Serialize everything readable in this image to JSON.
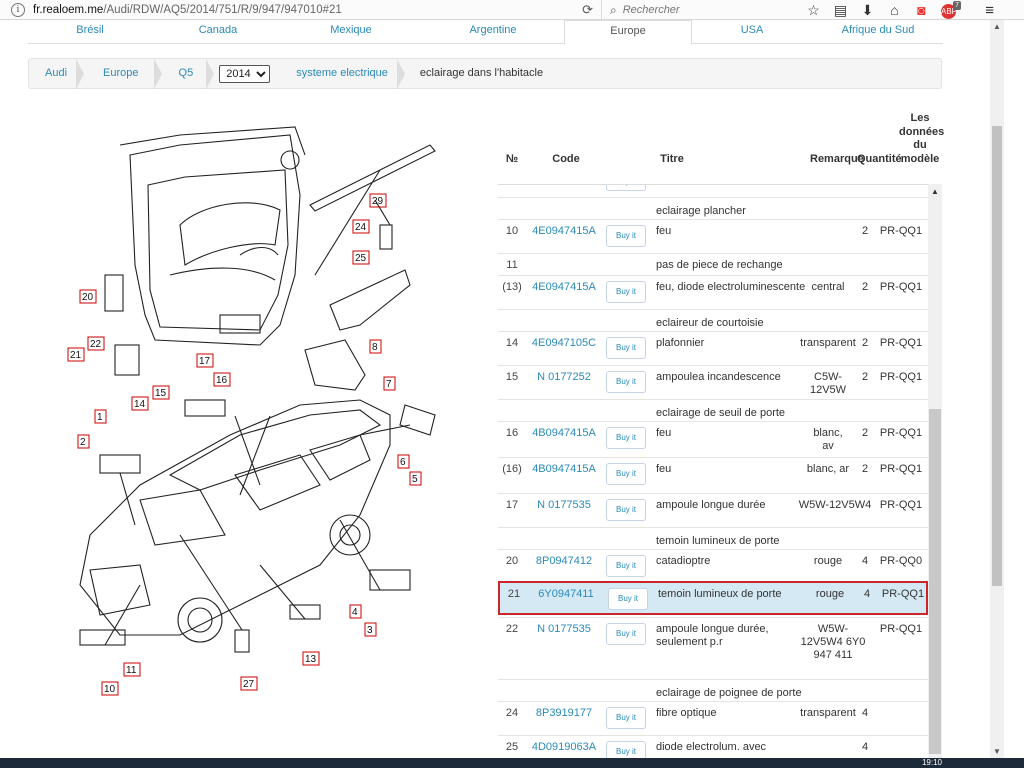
{
  "browser": {
    "url_domain": "fr.realoem.me",
    "url_path": "/Audi/RDW/AQ5/2014/751/R/9/947/947010#21",
    "search_placeholder": "Rechercher",
    "adblock_badge": "7"
  },
  "country_tabs": [
    "Brésil",
    "Canada",
    "Mexique",
    "Argentine",
    "Europe",
    "USA",
    "Afrique du Sud"
  ],
  "active_tab": "Europe",
  "breadcrumb": {
    "brand": "Audi",
    "region": "Europe",
    "model": "Q5",
    "year": "2014",
    "group": "systeme electrique",
    "current": "eclairage dans l'habitacle"
  },
  "diagram_labels": [
    "1",
    "2",
    "3",
    "4",
    "5",
    "6",
    "7",
    "8",
    "10",
    "11",
    "13",
    "14",
    "15",
    "16",
    "17",
    "20",
    "21",
    "22",
    "24",
    "25",
    "27",
    "29"
  ],
  "table": {
    "headers": {
      "num": "№",
      "code": "Code",
      "title": "Titre",
      "remark": "Remarque",
      "qty": "Quantité",
      "model": "Les données du modèle"
    },
    "buy_label": "Buy it",
    "groups": [
      "eclairage plancher",
      "eclaireur de courtoisie",
      "eclairage de seuil de porte",
      "temoin lumineux de porte",
      "eclairage de poignee de porte"
    ],
    "rows": [
      {
        "num": "10",
        "code": "4E0947415A",
        "title": "feu",
        "remark": "",
        "qty": "2",
        "model": "PR-QQ1"
      },
      {
        "num": "11",
        "code": "",
        "title": "pas de piece de rechange",
        "remark": "",
        "qty": "",
        "model": ""
      },
      {
        "num": "(13)",
        "code": "4E0947415A",
        "title": "feu, diode electroluminescente",
        "remark": "central",
        "qty": "2",
        "model": "PR-QQ1"
      },
      {
        "num": "14",
        "code": "4E0947105C",
        "title": "plafonnier",
        "remark": "transparent",
        "qty": "2",
        "model": "PR-QQ1"
      },
      {
        "num": "15",
        "code": "N 0177252",
        "title": "ampoulea incandescence",
        "remark": "C5W-12V5W",
        "qty": "2",
        "model": "PR-QQ1"
      },
      {
        "num": "16",
        "code": "4B0947415A",
        "title": "feu",
        "remark": "blanc, av",
        "qty": "2",
        "model": "PR-QQ1"
      },
      {
        "num": "(16)",
        "code": "4B0947415A",
        "title": "feu",
        "remark": "blanc, ar",
        "qty": "2",
        "model": "PR-QQ1"
      },
      {
        "num": "17",
        "code": "N 0177535",
        "title": "ampoule longue durée",
        "remark": "W5W-12V5W4",
        "qty": "",
        "model": "PR-QQ1"
      },
      {
        "num": "20",
        "code": "8P0947412",
        "title": "catadioptre",
        "remark": "rouge",
        "qty": "4",
        "model": "PR-QQ0"
      },
      {
        "num": "21",
        "code": "6Y0947411",
        "title": "temoin lumineux de porte",
        "remark": "rouge",
        "qty": "4",
        "model": "PR-QQ1"
      },
      {
        "num": "22",
        "code": "N 0177535",
        "title": "ampoule longue durée, seulement p.r",
        "remark": "W5W-12V5W4 6Y0 947 411",
        "qty": "",
        "model": "PR-QQ1"
      },
      {
        "num": "24",
        "code": "8P3919177",
        "title": "fibre optique",
        "remark": "transparent",
        "qty": "4",
        "model": ""
      },
      {
        "num": "25",
        "code": "4D0919063A",
        "title": "diode electrolum. avec",
        "remark": "",
        "qty": "4",
        "model": ""
      }
    ]
  },
  "taskbar": {
    "clock": "19:10"
  }
}
